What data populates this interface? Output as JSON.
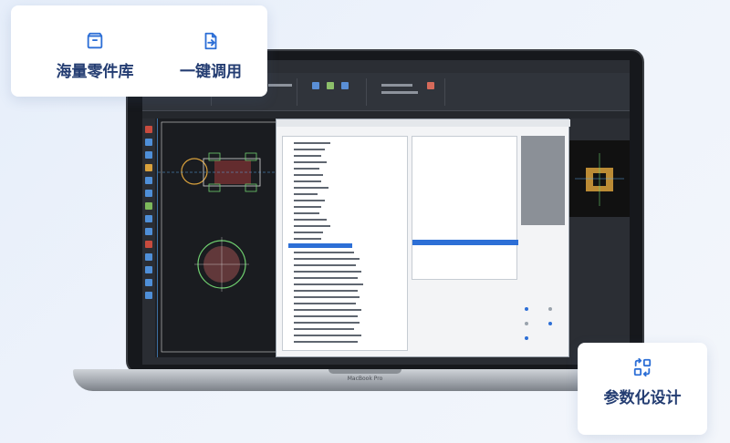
{
  "features": {
    "parts_library": {
      "label": "海量零件库",
      "icon": "box-icon"
    },
    "one_key_call": {
      "label": "一键调用",
      "icon": "document-arrow-icon"
    },
    "parametric_design": {
      "label": "参数化设计",
      "icon": "exchange-icon"
    }
  },
  "laptop": {
    "brand": "MacBook Pro"
  },
  "colors": {
    "accent": "#2d6fd6",
    "card_text": "#243d72",
    "background": "#e9eff9"
  }
}
